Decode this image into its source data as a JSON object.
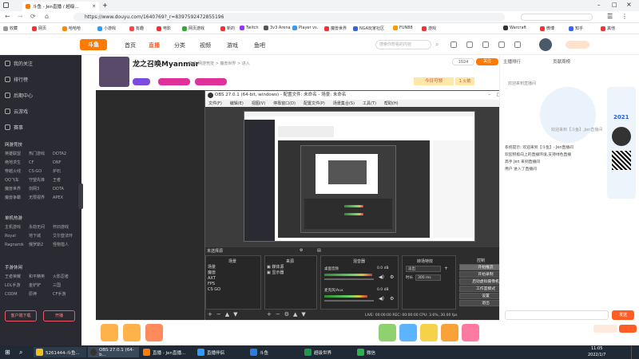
{
  "browser": {
    "tabs": [
      {
        "label": "斗鱼 - Jen直播 / 超级..."
      },
      {
        "label": "主页面 - Jen直播 /"
      }
    ],
    "url": "https://www.douyu.com/1640769?_r=8397592472855196",
    "bookmarks": [
      "收藏",
      "网页",
      "哈哈哈",
      "小游戏",
      "有趣",
      "电影",
      "网页游戏",
      "网页游戏",
      "新的",
      "Twitch",
      "3v3 Arena",
      "Player vs.",
      "魔兽世界",
      "NGA玩家社区",
      "FUN88",
      "游戏",
      "Warcraft",
      "微博",
      "知乎",
      "其他"
    ]
  },
  "douyu": {
    "nav": [
      "首页",
      "直播",
      "分类",
      "视频",
      "游戏",
      "鱼吧"
    ],
    "search_placeholder": "搜索你想看的内容"
  },
  "sidebar": {
    "items": [
      "我的关注",
      "排行榜",
      "后期中心",
      "云游戏",
      "赛事"
    ],
    "section1": "网游竞技",
    "grid1": [
      [
        "英雄联盟",
        "热门游戏",
        "DOTA2"
      ],
      [
        "绝地求生",
        "CF",
        "DNF"
      ],
      [
        "穿越火线",
        "CS:GO",
        "炉石"
      ],
      [
        "QQ飞车",
        "守望先锋",
        "王者"
      ],
      [
        "魔兽世界",
        "剑网3",
        "DOTA"
      ],
      [
        "魔兽争霸",
        "无限视界",
        "APEX"
      ]
    ],
    "section2": "单机热游",
    "grid2": [
      [
        "主机游戏",
        "永劫无间",
        "怀旧游戏"
      ],
      [
        "Royal",
        "地下城",
        "艾尔登法环"
      ],
      [
        "Ragnarok",
        "俄罗斯2",
        "怪物猎人"
      ]
    ],
    "section3": "手游休闲",
    "grid3": [
      [
        "王者荣耀",
        "和平精英",
        "火影忍者"
      ],
      [
        "LOL手游",
        "金铲铲",
        "三国"
      ],
      [
        "CODM",
        "原神",
        "CF手游"
      ]
    ],
    "btn_download": "客户端下载",
    "btn_open": "开播"
  },
  "room": {
    "title": "龙之召唤Myanmar",
    "category": "魔兽",
    "sub": "网游竞技 > 魔兽世界 > 进入",
    "followers": "1024",
    "follow_label": "关注",
    "rank_label": "今日可领",
    "rank_value": "1 火箭"
  },
  "obs": {
    "title": "OBS 27.0.1 (64-bit, windows) - 配置文件: 未命名 - 场景: 未命名",
    "menu": [
      "文件(F)",
      "编辑(E)",
      "视图(V)",
      "停靠窗口(D)",
      "配置文件(P)",
      "场景集合(S)",
      "工具(T)",
      "帮助(H)"
    ],
    "scene_label": "未选择源",
    "panels": {
      "scenes": "场景",
      "sources": "来源",
      "mixer": "混音器",
      "transitions": "转场特效",
      "controls": "控制"
    },
    "scenes": [
      "场景",
      "魔兽",
      "AXT",
      "FPS",
      "CS GO"
    ],
    "sources": [
      "媒体源",
      "显示器"
    ],
    "mixer": [
      {
        "name": "桌面音频",
        "db": "0.0 dB"
      },
      {
        "name": "麦克风/Aux",
        "db": "0.0 dB"
      }
    ],
    "transition": "淡出",
    "duration_label": "时长",
    "duration": "300 ms",
    "controls": [
      "开始推流",
      "开始录制",
      "启动虚拟摄像机",
      "工作室模式",
      "设置",
      "退出"
    ],
    "status": "LIVE: 00:00:00   REC: 00:00:00   CPU: 3.6%, 30.00 fps"
  },
  "right": {
    "tab1": "主播排行",
    "tab2": "贡献周榜",
    "chat_header": "欢迎来到直播间",
    "welcome_text": "欢迎来到【斗鱼】,Jen直播间",
    "year": "2021",
    "send_label": "发送",
    "chat_lines": [
      "系统提示: 欢迎来到【斗鱼】- Jen直播间",
      "欢迎积极向上的直播环境,支持绿色直播",
      "高手 Jen 来到直播间",
      "用户 进入了直播间"
    ]
  },
  "taskbar": {
    "items": [
      "5261444-斗鱼...",
      "OBS 27.0.1 (64-b...",
      "直播 - Jen直播...",
      "直播伴侣",
      "斗鱼",
      "超级世界",
      "微信"
    ],
    "time": "11:05",
    "date": "2022/1/7"
  }
}
